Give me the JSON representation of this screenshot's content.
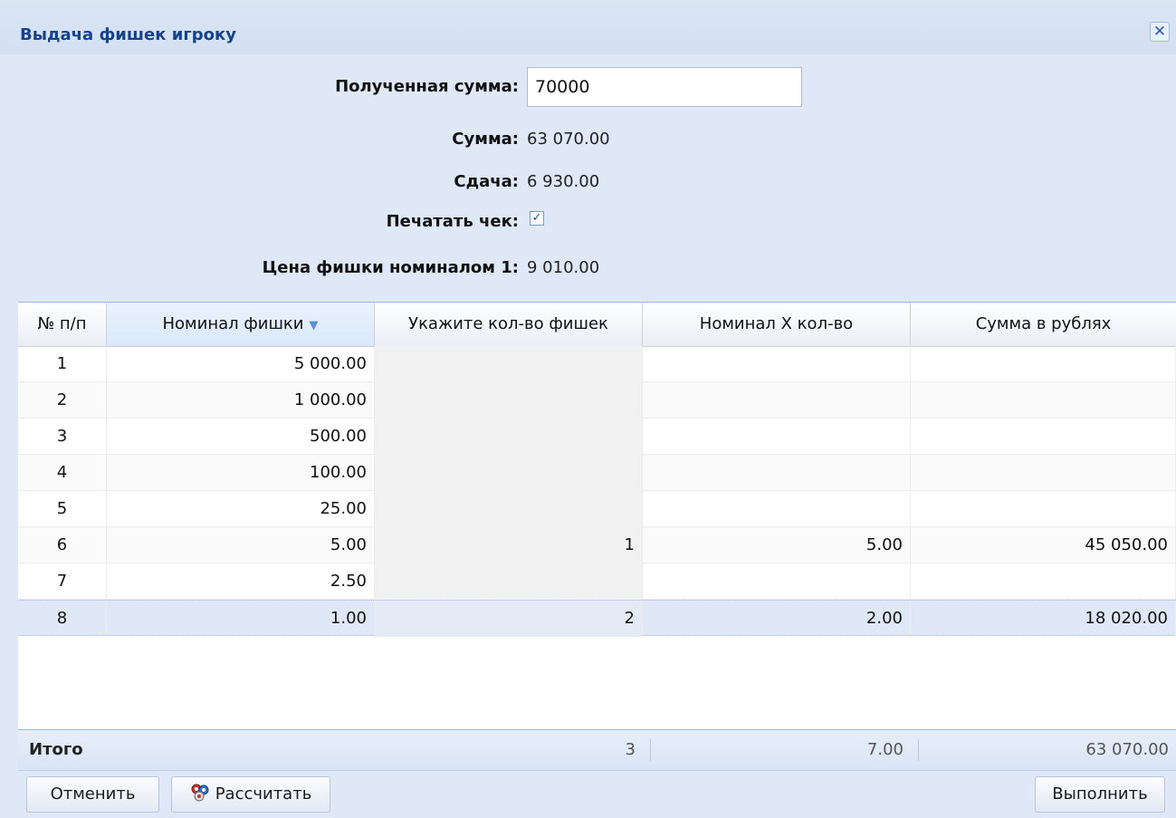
{
  "window": {
    "title": "Выдача фишек игроку",
    "close_glyph": "✕"
  },
  "form": {
    "received_label": "Полученная сумма:",
    "received_value": "70000",
    "sum_label": "Сумма:",
    "sum_value": "63 070.00",
    "change_label": "Сдача:",
    "change_value": "6 930.00",
    "print_label": "Печатать чек:",
    "print_checked": true,
    "price_label": "Цена фишки номиналом 1:",
    "price_value": "9 010.00"
  },
  "grid": {
    "headers": [
      "№ п/п",
      "Номинал фишки",
      "Укажите кол-во фишек",
      "Номинал X кол-во",
      "Сумма в рублях"
    ],
    "sort_indicator": "▼",
    "rows": [
      {
        "n": "1",
        "nominal": "5 000.00",
        "qty": "",
        "product": "",
        "sum": ""
      },
      {
        "n": "2",
        "nominal": "1 000.00",
        "qty": "",
        "product": "",
        "sum": ""
      },
      {
        "n": "3",
        "nominal": "500.00",
        "qty": "",
        "product": "",
        "sum": ""
      },
      {
        "n": "4",
        "nominal": "100.00",
        "qty": "",
        "product": "",
        "sum": ""
      },
      {
        "n": "5",
        "nominal": "25.00",
        "qty": "",
        "product": "",
        "sum": ""
      },
      {
        "n": "6",
        "nominal": "5.00",
        "qty": "1",
        "product": "5.00",
        "sum": "45 050.00"
      },
      {
        "n": "7",
        "nominal": "2.50",
        "qty": "",
        "product": "",
        "sum": ""
      },
      {
        "n": "8",
        "nominal": "1.00",
        "qty": "2",
        "product": "2.00",
        "sum": "18 020.00"
      }
    ]
  },
  "totals": {
    "label": "Итого",
    "qty": "3",
    "product": "7.00",
    "sum": "63 070.00"
  },
  "buttons": {
    "cancel": "Отменить",
    "calculate": "Рассчитать",
    "execute": "Выполнить"
  },
  "icons": {
    "calculate": "poker-chips-icon"
  }
}
